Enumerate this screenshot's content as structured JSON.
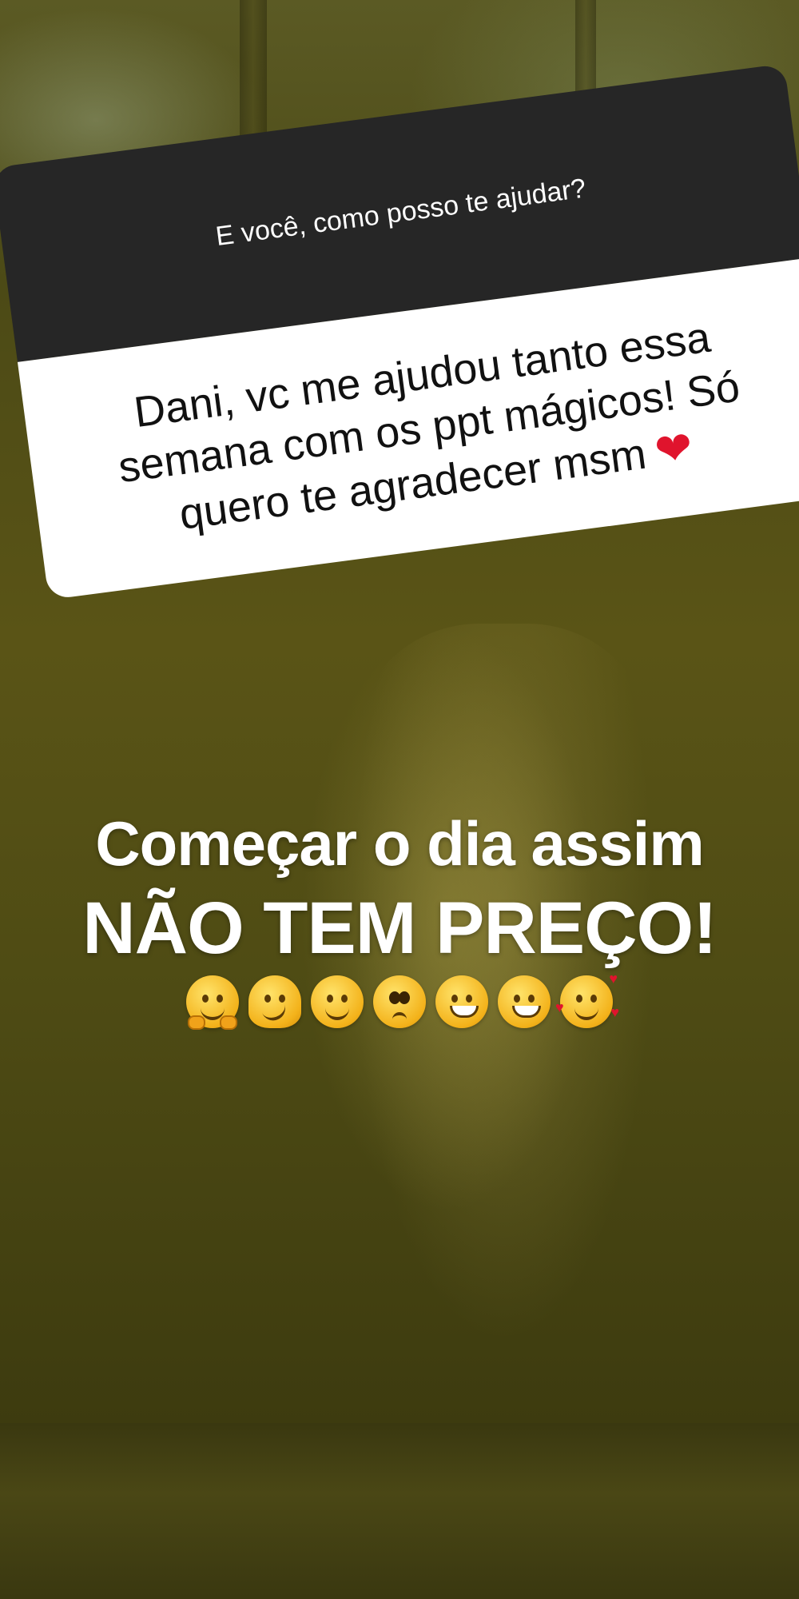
{
  "question": {
    "prompt": "E você, como posso te ajudar?",
    "answer": "Dani, vc me ajudou tanto essa semana com os ppt mágicos! Só quero te agradecer msm",
    "answer_emoji": "heart-emoji"
  },
  "caption": {
    "line1": "Começar o dia assim",
    "line2": "NÃO TEM PREÇO!"
  },
  "emojis": [
    "hugging-face-emoji",
    "melting-face-emoji",
    "smiling-face-emoji",
    "pleading-face-emoji",
    "grinning-face-emoji",
    "grinning-face-emoji",
    "smiling-face-with-hearts-emoji"
  ],
  "colors": {
    "question_header": "#262626",
    "question_body": "#ffffff",
    "heart": "#e0142d",
    "caption_text": "#ffffff"
  }
}
